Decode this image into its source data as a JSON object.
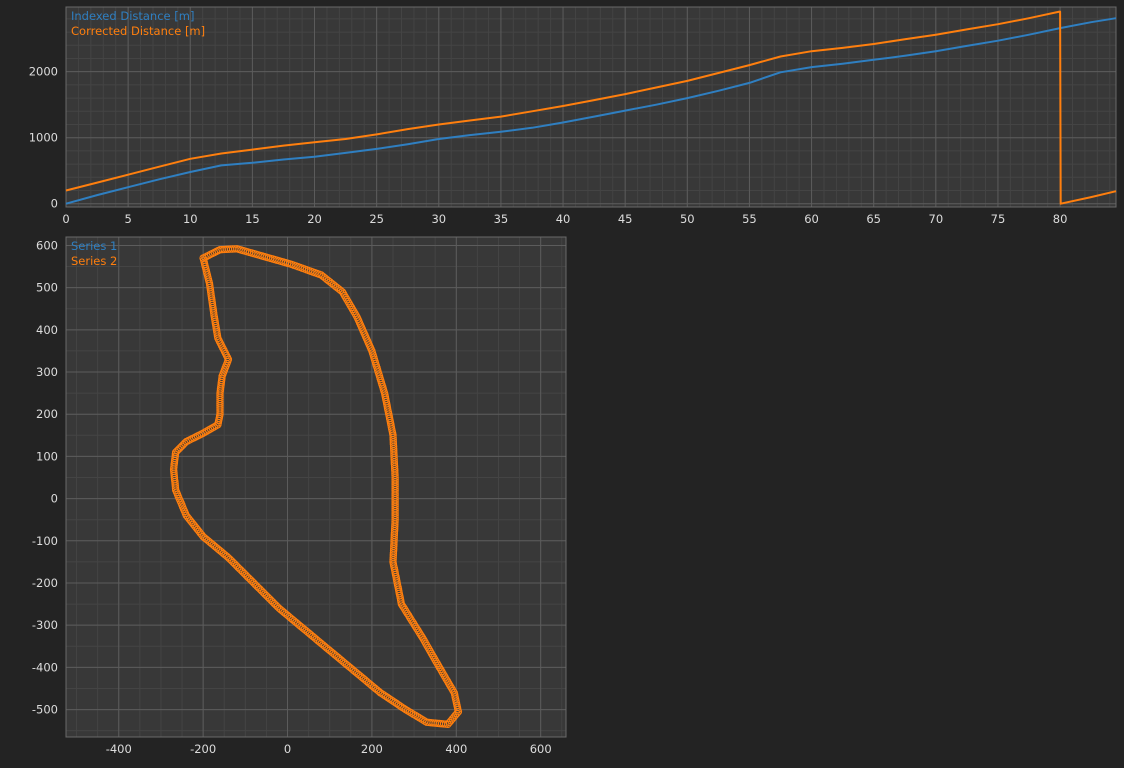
{
  "theme": {
    "background": "#232323",
    "plot_background": "#383838",
    "grid_major": "#5c5c5c",
    "grid_minor": "#444444",
    "text": "#dcdcdc",
    "series_blue": "#2f7fc1",
    "series_orange": "#ff7f0e"
  },
  "chart_data": [
    {
      "type": "line",
      "title": "",
      "xlabel": "",
      "ylabel": "",
      "xlim": [
        0,
        84.5
      ],
      "ylim": [
        -50,
        2980
      ],
      "x_ticks": [
        0,
        5,
        10,
        15,
        20,
        25,
        30,
        35,
        40,
        45,
        50,
        55,
        60,
        65,
        70,
        75,
        80
      ],
      "y_ticks": [
        0,
        1000,
        2000
      ],
      "grid": true,
      "legend": "top-left",
      "series": [
        {
          "name": "Indexed Distance [m]",
          "color": "#2f7fc1",
          "x": [
            0,
            2.5,
            5,
            7.5,
            10,
            12.5,
            15,
            17.5,
            20,
            22.5,
            25,
            27.5,
            30,
            32.5,
            35,
            37.5,
            40,
            42.5,
            45,
            47.5,
            50,
            52.5,
            55,
            57.5,
            60,
            62.5,
            65,
            67.5,
            70,
            72.5,
            75,
            77.5,
            80,
            82.5,
            84.5
          ],
          "y": [
            0,
            130,
            250,
            370,
            480,
            580,
            620,
            670,
            710,
            770,
            830,
            900,
            980,
            1040,
            1090,
            1150,
            1230,
            1320,
            1410,
            1500,
            1600,
            1710,
            1830,
            1990,
            2070,
            2120,
            2180,
            2240,
            2310,
            2390,
            2470,
            2560,
            2660,
            2750,
            2810
          ]
        },
        {
          "name": "Corrected Distance [m]",
          "color": "#ff7f0e",
          "x": [
            0,
            2.5,
            5,
            7.5,
            10,
            12.5,
            15,
            17.5,
            20,
            22.5,
            25,
            27.5,
            30,
            32.5,
            35,
            37.5,
            40,
            42.5,
            45,
            47.5,
            50,
            52.5,
            55,
            57.5,
            60,
            62.5,
            65,
            67.5,
            70,
            72.5,
            75,
            77.5,
            79.95,
            80,
            80.05,
            82.5,
            84.5
          ],
          "y": [
            200,
            320,
            440,
            560,
            680,
            760,
            820,
            880,
            930,
            980,
            1050,
            1130,
            1200,
            1260,
            1320,
            1400,
            1480,
            1570,
            1660,
            1760,
            1860,
            1980,
            2100,
            2230,
            2310,
            2360,
            2420,
            2490,
            2560,
            2640,
            2720,
            2810,
            2910,
            2910,
            0,
            100,
            190
          ]
        }
      ]
    },
    {
      "type": "scatter",
      "title": "",
      "xlabel": "",
      "ylabel": "",
      "xlim": [
        -525,
        660
      ],
      "ylim": [
        -565,
        620
      ],
      "x_ticks": [
        -400,
        -200,
        0,
        200,
        400,
        600
      ],
      "y_ticks": [
        -500,
        -400,
        -300,
        -200,
        -100,
        0,
        100,
        200,
        300,
        400,
        500,
        600
      ],
      "grid": true,
      "legend": "top-left",
      "series": [
        {
          "name": "Series 1",
          "color": "#2f7fc1",
          "points": []
        },
        {
          "name": "Series 2",
          "color": "#ff7f0e",
          "marker": "open-circle",
          "points": [
            [
              -160,
              590
            ],
            [
              -200,
              570
            ],
            [
              -185,
              510
            ],
            [
              -175,
              440
            ],
            [
              -165,
              380
            ],
            [
              -140,
              330
            ],
            [
              -155,
              290
            ],
            [
              -160,
              250
            ],
            [
              -160,
              200
            ],
            [
              -165,
              175
            ],
            [
              -200,
              155
            ],
            [
              -240,
              135
            ],
            [
              -265,
              110
            ],
            [
              -270,
              70
            ],
            [
              -265,
              20
            ],
            [
              -240,
              -40
            ],
            [
              -200,
              -90
            ],
            [
              -140,
              -140
            ],
            [
              -80,
              -200
            ],
            [
              -20,
              -260
            ],
            [
              40,
              -310
            ],
            [
              100,
              -360
            ],
            [
              160,
              -410
            ],
            [
              220,
              -460
            ],
            [
              280,
              -500
            ],
            [
              330,
              -530
            ],
            [
              380,
              -535
            ],
            [
              405,
              -505
            ],
            [
              395,
              -460
            ],
            [
              360,
              -400
            ],
            [
              320,
              -330
            ],
            [
              270,
              -250
            ],
            [
              250,
              -150
            ],
            [
              255,
              -50
            ],
            [
              255,
              50
            ],
            [
              250,
              150
            ],
            [
              230,
              250
            ],
            [
              200,
              350
            ],
            [
              165,
              430
            ],
            [
              130,
              490
            ],
            [
              80,
              530
            ],
            [
              10,
              555
            ],
            [
              -60,
              575
            ],
            [
              -120,
              592
            ],
            [
              -160,
              590
            ]
          ]
        }
      ]
    }
  ]
}
